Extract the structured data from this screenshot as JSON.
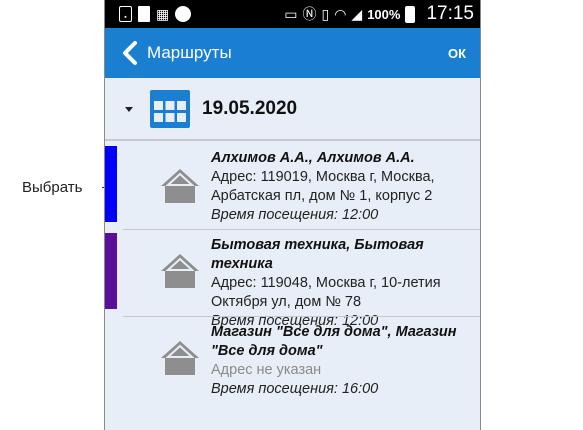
{
  "callout": {
    "label": "Выбрать"
  },
  "status_bar": {
    "battery_text": "100%",
    "time": "17:15"
  },
  "app_bar": {
    "title": "Маршруты",
    "ok_label": "ОК"
  },
  "date_group": {
    "date": "19.05.2020"
  },
  "items": [
    {
      "title": "Алхимов А.А., Алхимов А.А.",
      "address_lines": [
        "Адрес: 119019, Москва г, Москва,",
        "Арбатская пл, дом № 1, корпус 2"
      ],
      "time": "Время посещения: 12:00",
      "stripe_color": "#0000ff"
    },
    {
      "title": "Бытовая техника, Бытовая техника",
      "address_lines": [
        "Адрес: 119048, Москва г, 10-летия",
        "Октября ул, дом № 78"
      ],
      "time": "Время посещения: 12:00",
      "stripe_color": "#5a0f9a"
    },
    {
      "title_lines": [
        "Магазин \"Все для дома\", Магазин",
        "\"Все для дома\""
      ],
      "address_missing": "Адрес не указан",
      "time": "Время посещения: 16:00"
    }
  ],
  "colors": {
    "app_bar": "#1b7fd1",
    "background": "#e8eef7",
    "icon_gray": "#8e8e8e",
    "calendar_blue": "#1b7fd1"
  }
}
